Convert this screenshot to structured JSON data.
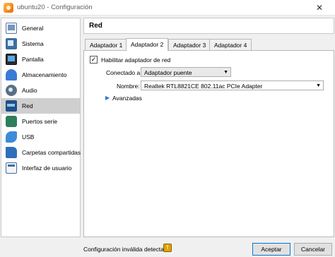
{
  "window": {
    "title": "ubuntu20 - Configuración",
    "close_glyph": "✕"
  },
  "sidebar": {
    "items": [
      {
        "label": "General",
        "icon": "general-icon"
      },
      {
        "label": "Sistema",
        "icon": "system-icon"
      },
      {
        "label": "Pantalla",
        "icon": "display-icon"
      },
      {
        "label": "Almacenamiento",
        "icon": "storage-icon"
      },
      {
        "label": "Audio",
        "icon": "audio-icon"
      },
      {
        "label": "Red",
        "icon": "network-icon",
        "selected": true
      },
      {
        "label": "Puertos serie",
        "icon": "serial-ports-icon"
      },
      {
        "label": "USB",
        "icon": "usb-icon"
      },
      {
        "label": "Carpetas compartidas",
        "icon": "shared-folders-icon"
      },
      {
        "label": "Interfaz de usuario",
        "icon": "user-interface-icon"
      }
    ]
  },
  "section": {
    "title": "Red"
  },
  "tabs": [
    {
      "label": "Adaptador 1",
      "active": false
    },
    {
      "label": "Adaptador 2",
      "active": true
    },
    {
      "label": "Adaptador 3",
      "active": false
    },
    {
      "label": "Adaptador 4",
      "active": false
    }
  ],
  "adapter": {
    "enable_label": "Habilitar adaptador de red",
    "enabled": true,
    "check_glyph": "✓",
    "attached_label": "Conectado a:",
    "attached_value": "Adaptador puente",
    "name_label": "Nombre:",
    "name_value": "Realtek RTL8821CE 802.11ac PCIe Adapter",
    "advanced_label": "Avanzadas",
    "arrow_glyph": "▼",
    "expander_glyph": "▶"
  },
  "footer": {
    "status_text": "Configuración inválida detectada",
    "warn_glyph": "!",
    "ok_label": "Aceptar",
    "cancel_label": "Cancelar"
  },
  "colors": {
    "selected_item_bg": "#cfcfcf",
    "primary_button_border": "#0078d7",
    "expander_arrow": "#2a7bd3"
  }
}
